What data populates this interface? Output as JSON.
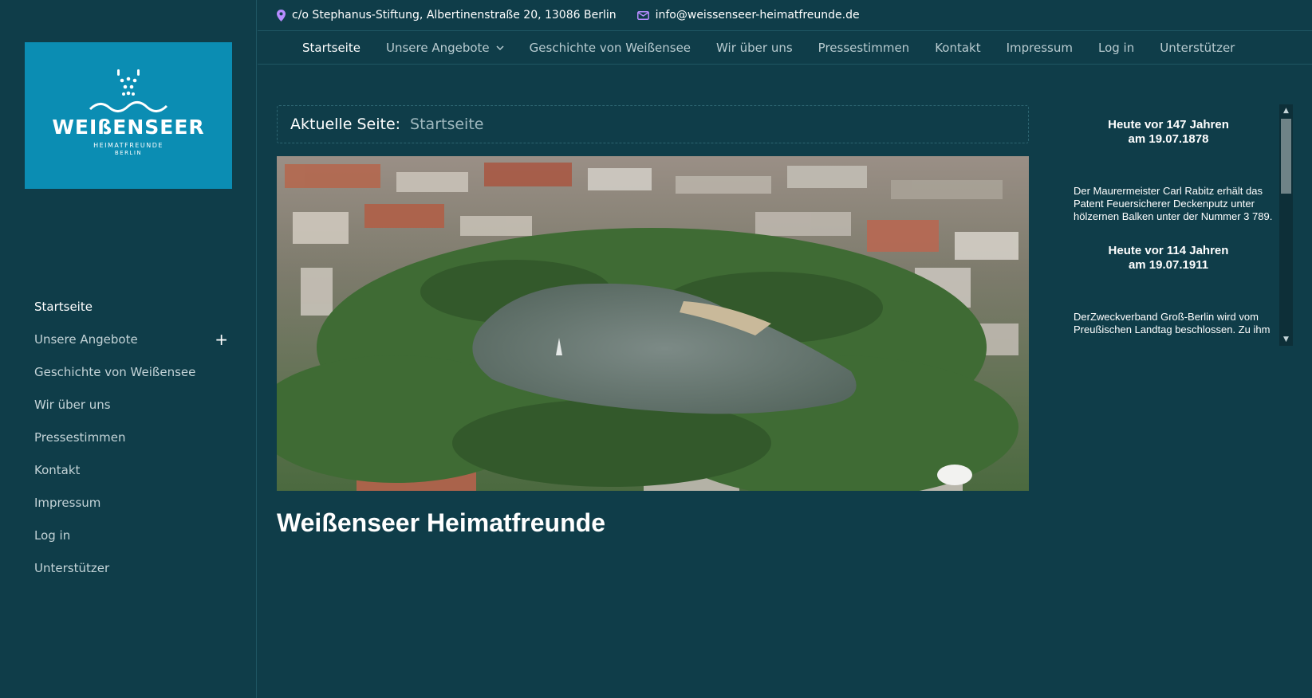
{
  "sidebar": {
    "logo": {
      "word": "WEIßENSEER",
      "sub": "HEIMATFREUNDE",
      "sub2": "BERLIN"
    },
    "items": [
      {
        "label": "Startseite"
      },
      {
        "label": "Unsere Angebote",
        "expand": "+"
      },
      {
        "label": "Geschichte von Weißensee"
      },
      {
        "label": "Wir über uns"
      },
      {
        "label": "Pressestimmen"
      },
      {
        "label": "Kontakt"
      },
      {
        "label": "Impressum"
      },
      {
        "label": "Log in"
      },
      {
        "label": "Unterstützer"
      }
    ]
  },
  "topbar": {
    "address": "c/o Stephanus-Stiftung, Albertinenstraße 20, 13086 Berlin",
    "email": "info@weissenseer-heimatfreunde.de",
    "icon_color": "#b78cff"
  },
  "mainnav": {
    "items": [
      {
        "label": "Startseite"
      },
      {
        "label": "Unsere Angebote"
      },
      {
        "label": "Geschichte von Weißensee"
      },
      {
        "label": "Wir über uns"
      },
      {
        "label": "Pressestimmen"
      },
      {
        "label": "Kontakt"
      },
      {
        "label": "Impressum"
      },
      {
        "label": "Log in"
      },
      {
        "label": "Unterstützer"
      }
    ]
  },
  "breadcrumb": {
    "label": "Aktuelle Seite:",
    "current": "Startseite"
  },
  "page": {
    "title": "Weißenseer Heimatfreunde"
  },
  "widget": {
    "entries": [
      {
        "head1": "Heute vor 147 Jahren",
        "head2": "am 19.07.1878",
        "text": "Der Maurermeister Carl Rabitz erhält das Patent Feuersicherer Deckenputz unter hölzernen Balken unter der Nummer 3 789."
      },
      {
        "head1": "Heute vor 114 Jahren",
        "head2": "am 19.07.1911",
        "text": "DerZweckverband Groß-Berlin wird vom Preußischen Landtag beschlossen. Zu ihm"
      }
    ]
  },
  "colors": {
    "background": "#0f3d49",
    "logo_bg": "#0b8db3"
  }
}
